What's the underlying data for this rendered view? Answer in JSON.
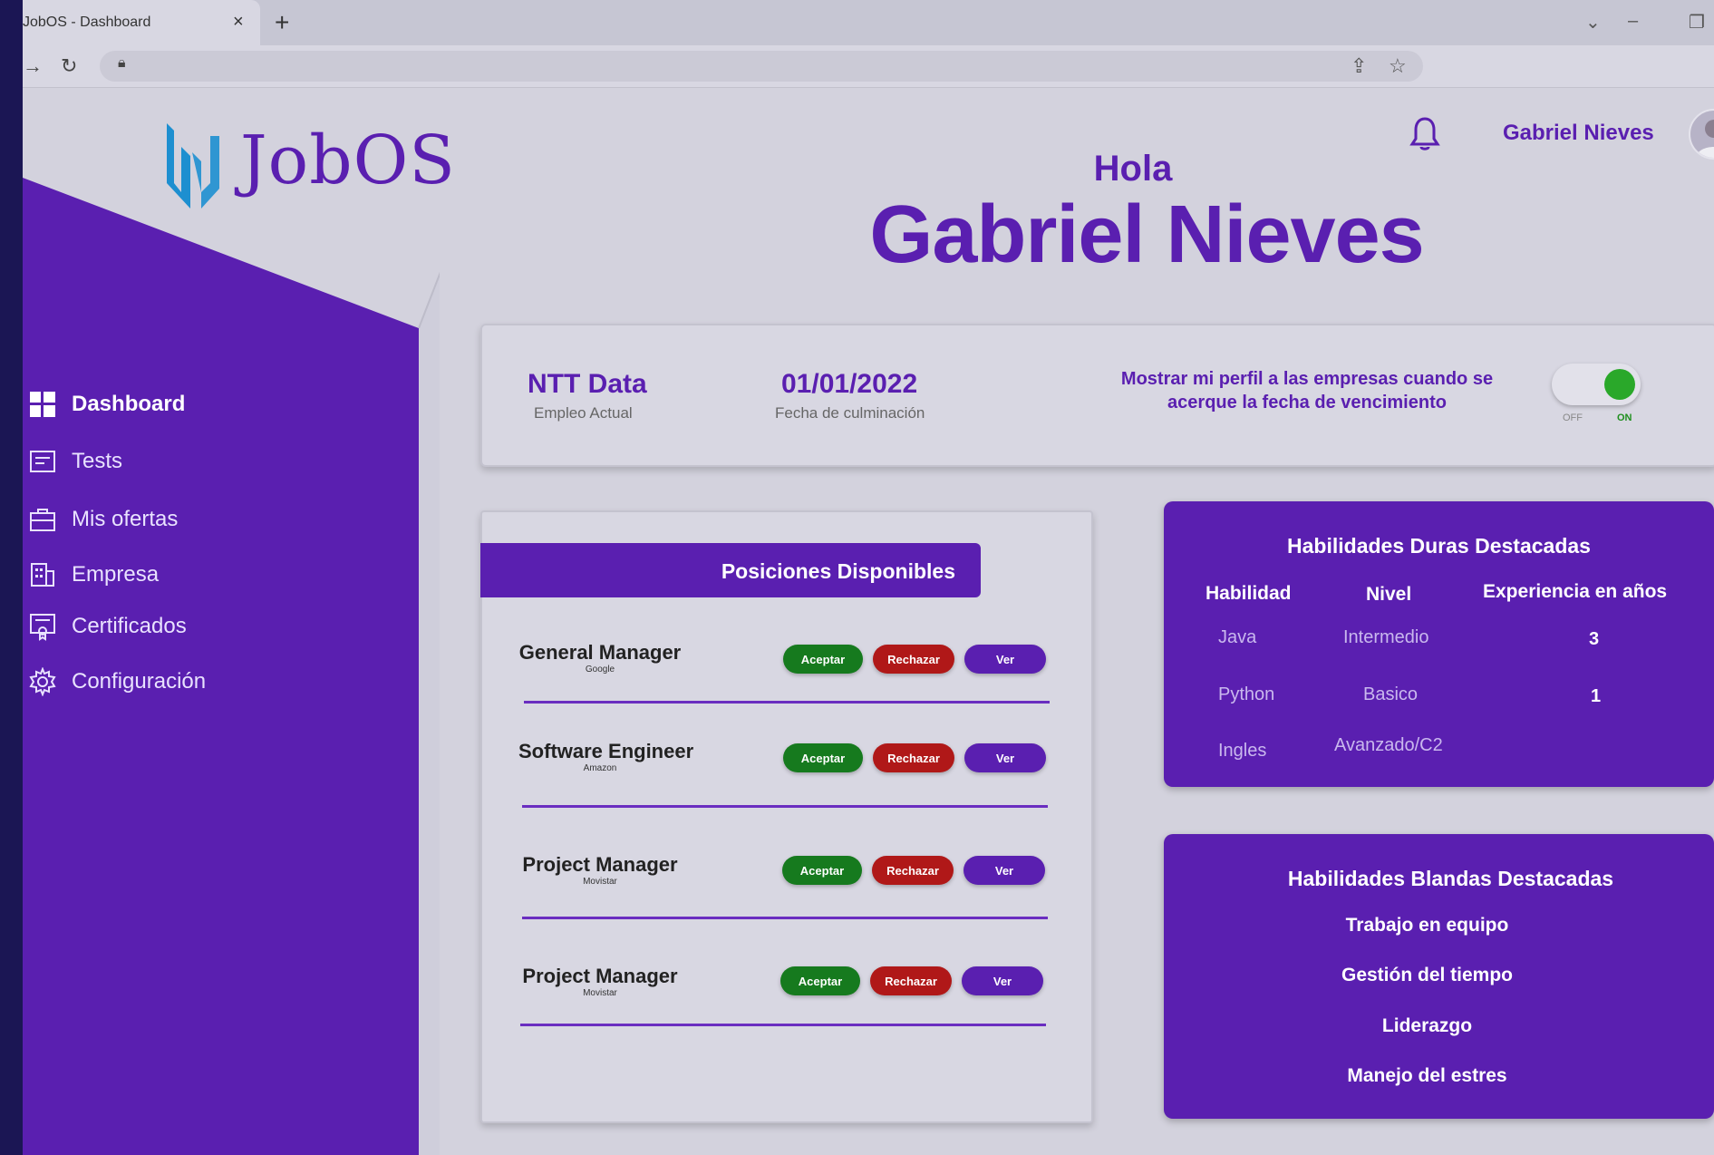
{
  "browser": {
    "tab_title": "JobOS - Dashboard",
    "close_glyph": "×",
    "new_tab_glyph": "+",
    "minimize_glyph": "–",
    "restore_glyph": "❐",
    "dropdown_glyph": "⌄"
  },
  "logo": {
    "text": "JobOS"
  },
  "sidebar": {
    "items": [
      {
        "label": "Dashboard",
        "icon": "dashboard-icon",
        "active": true
      },
      {
        "label": "Tests",
        "icon": "tests-icon"
      },
      {
        "label": "Mis ofertas",
        "icon": "briefcase-icon"
      },
      {
        "label": "Empresa",
        "icon": "building-icon"
      },
      {
        "label": "Certificados",
        "icon": "certificate-icon"
      },
      {
        "label": "Configuración",
        "icon": "gear-icon"
      }
    ]
  },
  "header": {
    "user_name": "Gabriel Nieves",
    "greeting": "Hola",
    "big_name": "Gabriel Nieves"
  },
  "job": {
    "company": "NTT Data",
    "company_caption": "Empleo Actual",
    "end_date": "01/01/2022",
    "end_date_caption": "Fecha de culminación",
    "profile_message": "Mostrar mi perfil a las empresas cuando se acerque la fecha de vencimiento",
    "toggle_off_label": "OFF",
    "toggle_on_label": "ON",
    "toggle_state": "on"
  },
  "positions": {
    "title": "Posiciones Disponibles",
    "accept_label": "Aceptar",
    "reject_label": "Rechazar",
    "view_label": "Ver",
    "rows": [
      {
        "title": "General Manager",
        "company": "Google"
      },
      {
        "title": "Software Engineer",
        "company": "Amazon"
      },
      {
        "title": "Project Manager",
        "company": "Movistar"
      },
      {
        "title": "Project Manager",
        "company": "Movistar"
      }
    ]
  },
  "hard_skills": {
    "title": "Habilidades Duras Destacadas",
    "headers": [
      "Habilidad",
      "Nivel",
      "Experiencia en años"
    ],
    "rows": [
      {
        "skill": "Java",
        "level": "Intermedio",
        "years": "3"
      },
      {
        "skill": "Python",
        "level": "Basico",
        "years": "1"
      },
      {
        "skill": "Ingles",
        "level": "Avanzado/C2",
        "years": ""
      }
    ]
  },
  "soft_skills": {
    "title": "Habilidades Blandas Destacadas",
    "items": [
      "Trabajo en equipo",
      "Gestión  del tiempo",
      "Liderazgo",
      "Manejo del estres"
    ]
  },
  "colors": {
    "primary": "#5a1fb0",
    "accept": "#167a1e",
    "reject": "#b01818",
    "background": "#d3d2dd"
  }
}
